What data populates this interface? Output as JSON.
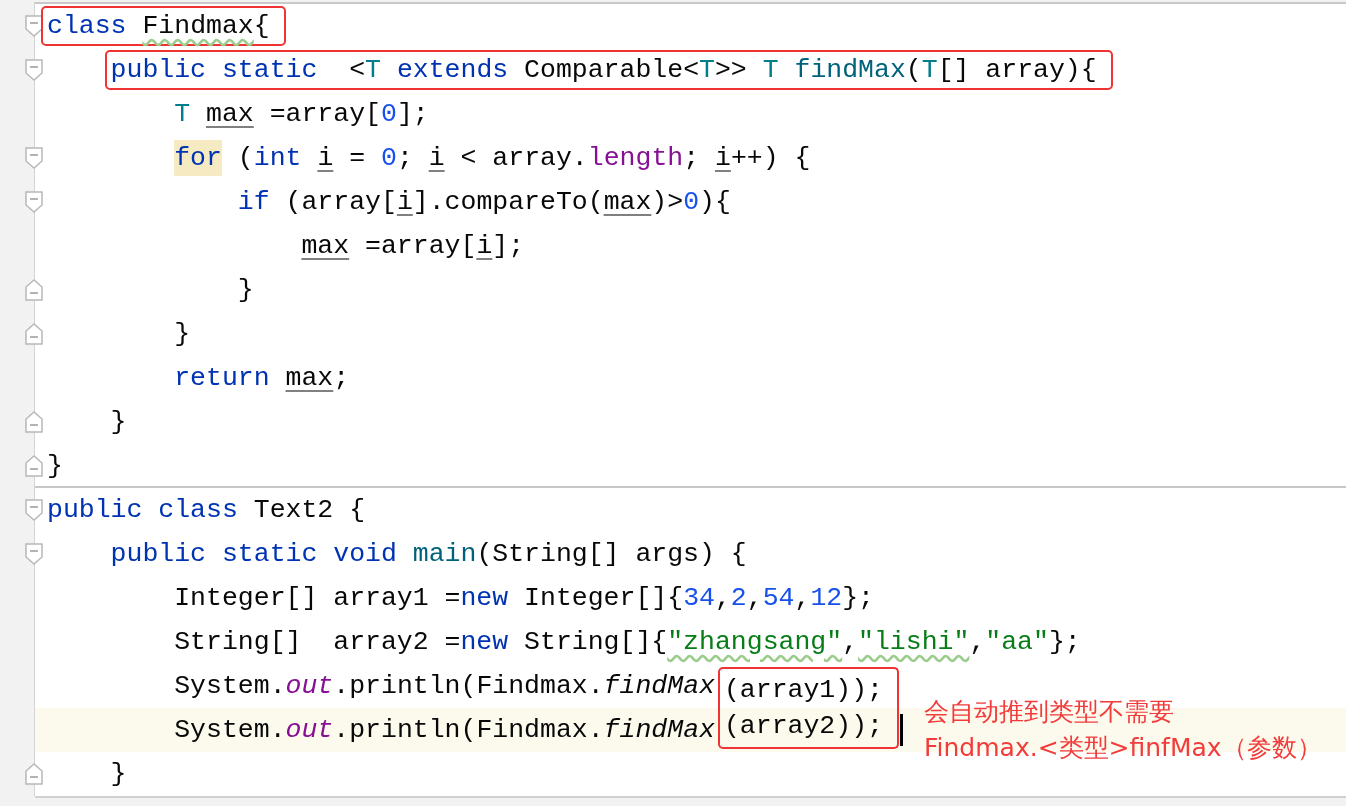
{
  "editor": {
    "lines": [
      {
        "fold_start": true,
        "outlined_tokens": [
          {
            "kind": "keyword",
            "text": "class"
          },
          {
            "kind": "warning",
            "text": " Findmax"
          },
          {
            "kind": "plain",
            "text": "{"
          }
        ]
      },
      {
        "fold_start": true,
        "outlined_tokens": [
          {
            "kind": "keyword",
            "text": "    public static"
          },
          {
            "kind": "plain",
            "text": "  <"
          },
          {
            "kind": "typeparam",
            "text": "T"
          },
          {
            "kind": "keyword",
            "text": " extends "
          },
          {
            "kind": "plain",
            "text": "Comparable<"
          },
          {
            "kind": "typeparam",
            "text": "T"
          },
          {
            "kind": "plain",
            "text": ">> "
          },
          {
            "kind": "typeparam",
            "text": "T "
          },
          {
            "kind": "declaration",
            "text": "findMax"
          },
          {
            "kind": "plain",
            "text": "("
          },
          {
            "kind": "typeparam",
            "text": "T"
          },
          {
            "kind": "plain",
            "text": "[] array){"
          }
        ]
      },
      {
        "tokens": [
          {
            "kind": "typeparam",
            "text": "        T"
          },
          {
            "kind": "variable",
            "text": " max"
          },
          {
            "kind": "plain",
            "text": " =array["
          },
          {
            "kind": "number",
            "text": "0"
          },
          {
            "kind": "plain",
            "text": "];"
          }
        ]
      },
      {
        "fold_start": true,
        "tokens": [
          {
            "kind": "matched",
            "text": "        for"
          },
          {
            "kind": "plain",
            "text": " ("
          },
          {
            "kind": "keyword",
            "text": "int"
          },
          {
            "kind": "variable",
            "text": " i"
          },
          {
            "kind": "plain",
            "text": " = "
          },
          {
            "kind": "number",
            "text": "0"
          },
          {
            "kind": "plain",
            "text": "; "
          },
          {
            "kind": "variable",
            "text": "i"
          },
          {
            "kind": "plain",
            "text": " < array."
          },
          {
            "kind": "field",
            "text": "length"
          },
          {
            "kind": "plain",
            "text": "; "
          },
          {
            "kind": "variable",
            "text": "i"
          },
          {
            "kind": "plain",
            "text": "++) {"
          }
        ]
      },
      {
        "fold_start": true,
        "tokens": [
          {
            "kind": "keyword",
            "text": "            if"
          },
          {
            "kind": "plain",
            "text": " (array["
          },
          {
            "kind": "variable",
            "text": "i"
          },
          {
            "kind": "plain",
            "text": "].compareTo("
          },
          {
            "kind": "variable",
            "text": "max"
          },
          {
            "kind": "plain",
            "text": ")>"
          },
          {
            "kind": "number",
            "text": "0"
          },
          {
            "kind": "plain",
            "text": "){"
          }
        ]
      },
      {
        "tokens": [
          {
            "kind": "variable",
            "text": "                max"
          },
          {
            "kind": "plain",
            "text": " =array["
          },
          {
            "kind": "variable",
            "text": "i"
          },
          {
            "kind": "plain",
            "text": "];"
          }
        ]
      },
      {
        "fold_end": true,
        "tokens": [
          {
            "kind": "plain",
            "text": "            }"
          }
        ]
      },
      {
        "fold_end": true,
        "tokens": [
          {
            "kind": "plain",
            "text": "        }"
          }
        ]
      },
      {
        "tokens": [
          {
            "kind": "keyword",
            "text": "        return"
          },
          {
            "kind": "variable",
            "text": " max"
          },
          {
            "kind": "plain",
            "text": ";"
          }
        ]
      },
      {
        "fold_end": true,
        "tokens": [
          {
            "kind": "plain",
            "text": "    }"
          }
        ]
      },
      {
        "fold_end": true,
        "tokens": [
          {
            "kind": "plain",
            "text": "}"
          }
        ]
      },
      {
        "fold_start": true,
        "separator": true,
        "tokens": [
          {
            "kind": "keyword",
            "text": "public class"
          },
          {
            "kind": "plain",
            "text": " Text2 {"
          }
        ]
      },
      {
        "fold_start": true,
        "tokens": [
          {
            "kind": "keyword",
            "text": "    public static void"
          },
          {
            "kind": "declaration",
            "text": " main"
          },
          {
            "kind": "plain",
            "text": "(String[] args) {"
          }
        ]
      },
      {
        "tokens": [
          {
            "kind": "plain",
            "text": "        Integer[] array1 ="
          },
          {
            "kind": "keyword",
            "text": "new"
          },
          {
            "kind": "plain",
            "text": " Integer[]{"
          },
          {
            "kind": "number",
            "text": "34"
          },
          {
            "kind": "plain",
            "text": ","
          },
          {
            "kind": "number",
            "text": "2"
          },
          {
            "kind": "plain",
            "text": ","
          },
          {
            "kind": "number",
            "text": "54"
          },
          {
            "kind": "plain",
            "text": ","
          },
          {
            "kind": "number",
            "text": "12"
          },
          {
            "kind": "plain",
            "text": "};"
          }
        ]
      },
      {
        "tokens": [
          {
            "kind": "plain",
            "text": "        String[]  array2 ="
          },
          {
            "kind": "keyword",
            "text": "new"
          },
          {
            "kind": "plain",
            "text": " String[]{"
          },
          {
            "kind": "string_warning",
            "text": "\"zhangsang\""
          },
          {
            "kind": "plain",
            "text": ","
          },
          {
            "kind": "string_warning",
            "text": "\"lishi\""
          },
          {
            "kind": "plain",
            "text": ","
          },
          {
            "kind": "string",
            "text": "\"aa\""
          },
          {
            "kind": "plain",
            "text": "};"
          }
        ]
      },
      {
        "tokens": [
          {
            "kind": "plain",
            "text": "        System."
          },
          {
            "kind": "static_field",
            "text": "out"
          },
          {
            "kind": "plain",
            "text": ".println(Findmax."
          },
          {
            "kind": "static_call",
            "text": "findMax"
          }
        ],
        "outlined_tokens": [
          {
            "kind": "plain",
            "text": "(array1));"
          }
        ]
      },
      {
        "current": true,
        "tokens": [
          {
            "kind": "plain",
            "text": "        System."
          },
          {
            "kind": "static_field",
            "text": "out"
          },
          {
            "kind": "plain",
            "text": ".println(Findmax."
          },
          {
            "kind": "static_call",
            "text": "findMax"
          }
        ],
        "outlined_tokens": [
          {
            "kind": "plain",
            "text": "(array2));"
          }
        ]
      },
      {
        "fold_end": true,
        "tokens": [
          {
            "kind": "plain",
            "text": "    }"
          }
        ]
      }
    ]
  },
  "note": {
    "lines": [
      "会自动推到类型不需要",
      "Findmax.<类型>finfMax（参数）"
    ]
  }
}
